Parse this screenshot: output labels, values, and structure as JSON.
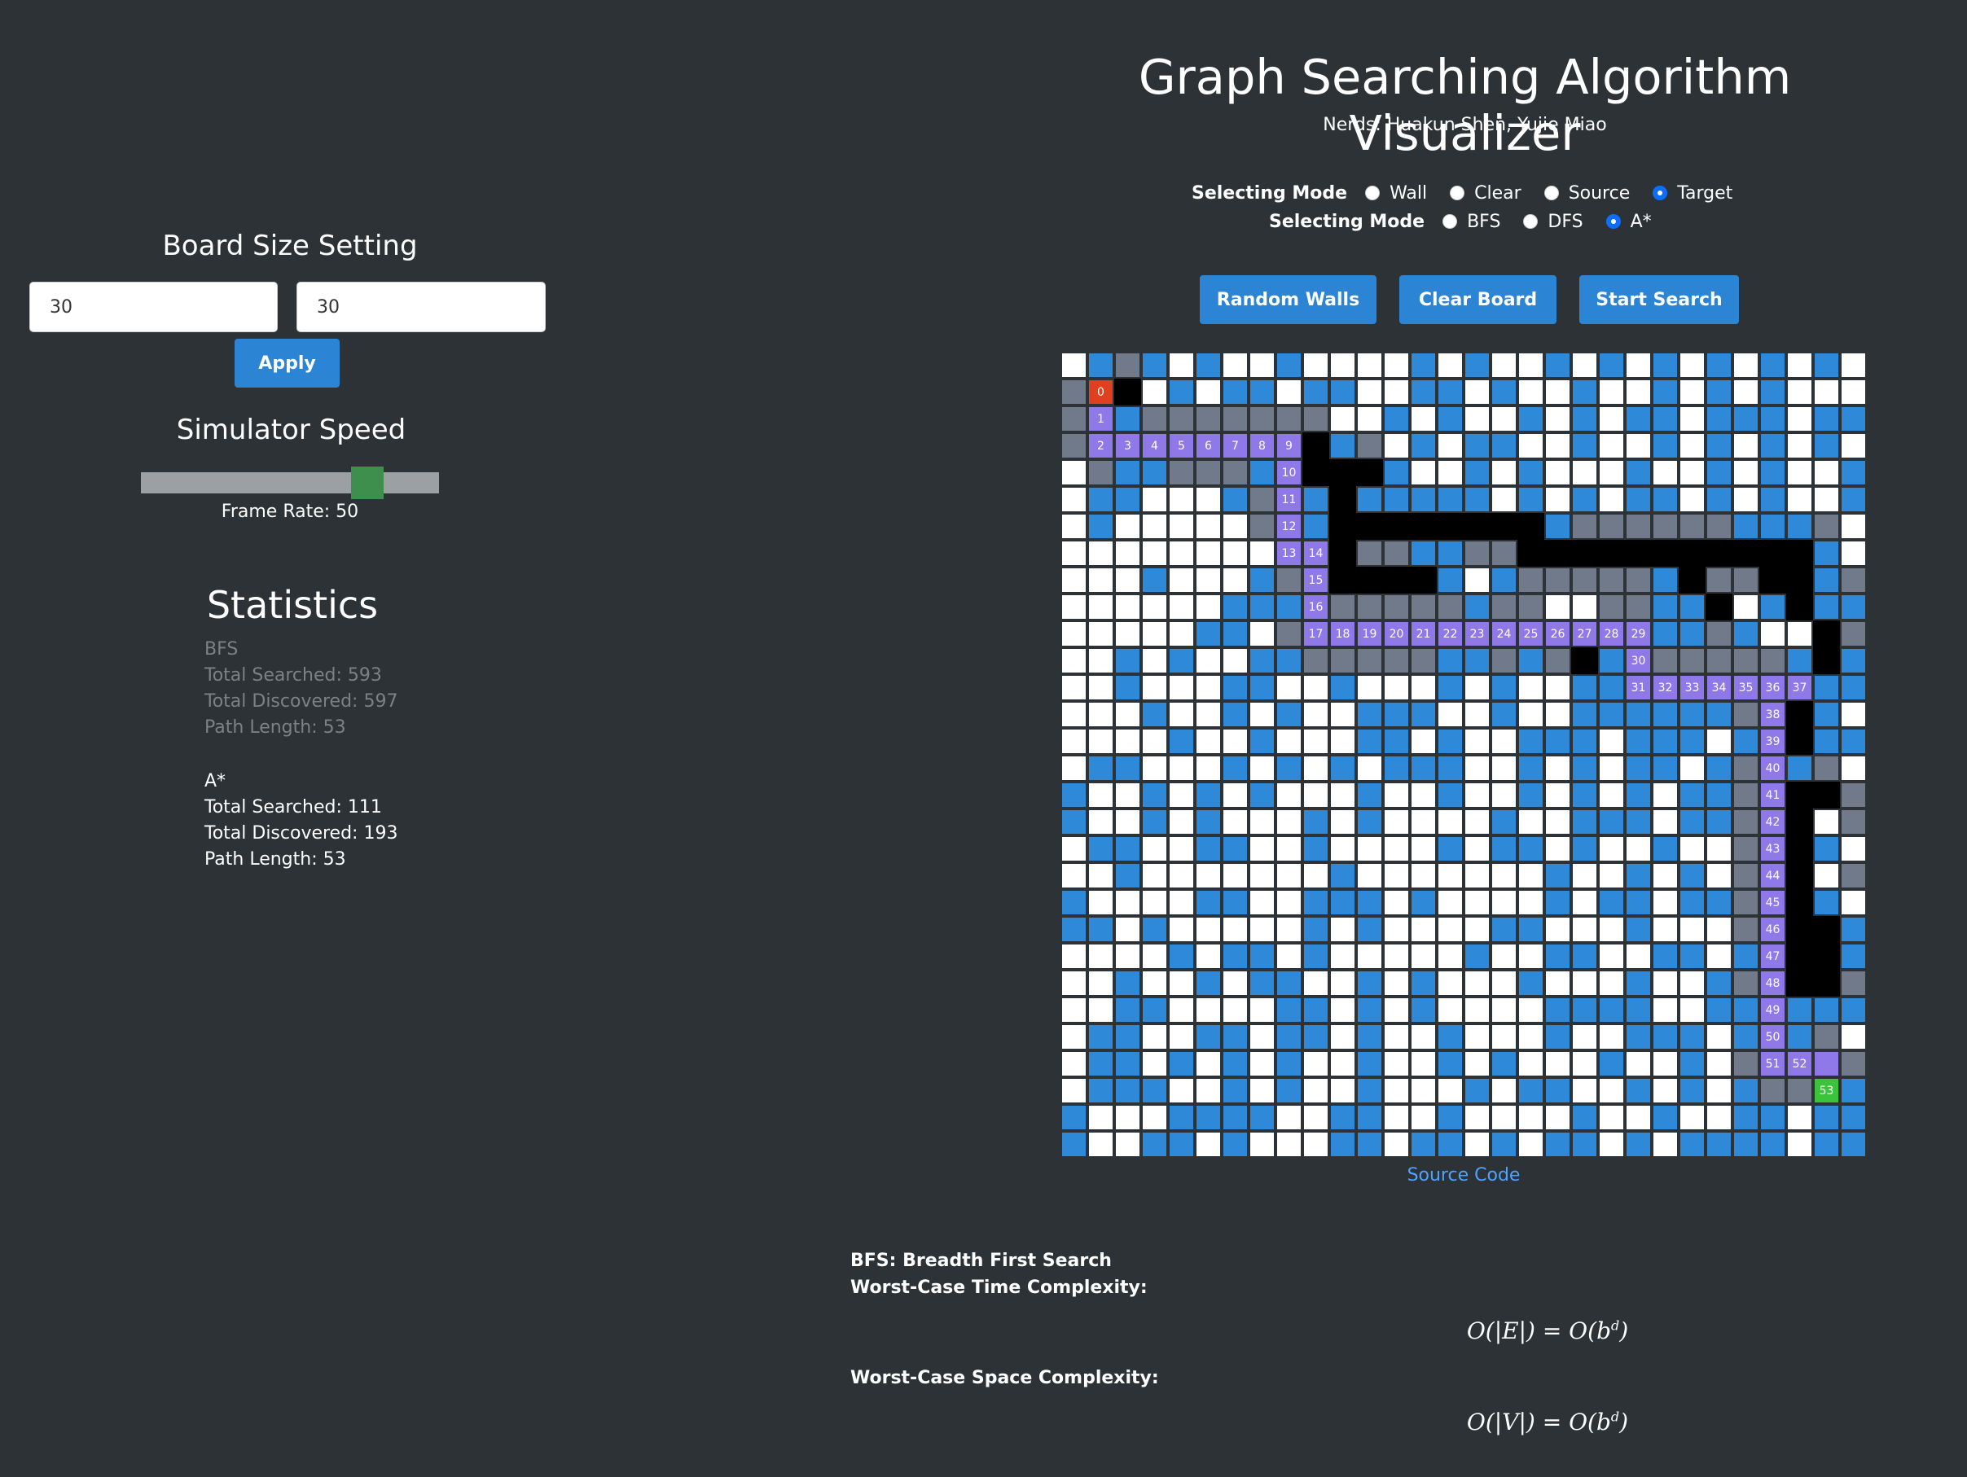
{
  "header": {
    "title": "Graph Searching Algorithm Visualizer",
    "subtitle": "Nerds: Huakun Shen, Yujie Miao"
  },
  "mode_row": {
    "label": "Selecting Mode",
    "options": [
      "Wall",
      "Clear",
      "Source",
      "Target"
    ],
    "selected": "Target"
  },
  "algo_row": {
    "label": "Selecting Mode",
    "options": [
      "BFS",
      "DFS",
      "A*"
    ],
    "selected": "A*"
  },
  "actions": {
    "random_walls": "Random Walls",
    "clear_board": "Clear Board",
    "start_search": "Start Search"
  },
  "board_settings": {
    "title": "Board Size Setting",
    "rows_value": "30",
    "cols_value": "30",
    "apply_label": "Apply"
  },
  "speed": {
    "title": "Simulator Speed",
    "frame_rate_text": "Frame Rate: 50",
    "slider_fraction": 0.79
  },
  "statistics": {
    "title": "Statistics",
    "bfs": {
      "name": "BFS",
      "total_searched": "Total Searched: 593",
      "total_discovered": "Total Discovered: 597",
      "path_length": "Path Length: 53"
    },
    "astar": {
      "name": "A*",
      "total_searched": "Total Searched: 111",
      "total_discovered": "Total Discovered: 193",
      "path_length": "Path Length: 53"
    }
  },
  "footer": {
    "source_link": "Source Code",
    "bfs_title": "BFS: Breadth First Search",
    "time_label": "Worst-Case Time Complexity:",
    "time_formula": "O(|E|) = O(b",
    "time_exp": "d",
    "space_label": "Worst-Case Space Complexity:",
    "space_formula": "O(|V|) = O(b",
    "space_exp": "d"
  },
  "colors": {
    "background": "#2c3236",
    "unvisited": "#ffffff",
    "discovered": "#2e8ad8",
    "searched": "#707a8a",
    "wall": "#000000",
    "path": "#8f79e8",
    "source": "#e0401f",
    "target": "#3bc43b",
    "button": "#2b84d4"
  },
  "grid": {
    "legend": "W=unvisited, B=discovered, G=searched, X=wall, S=source, T=target, P=path (labels in path_labels)",
    "rows": [
      "WBGBWBWWBWWWWBWBWWBWBWBWBWBWBW",
      "GSXWBWBBWBBWWBBWBWWBWWBWBWBWWW",
      "GPBGGGGGGGWWBWBWWBWBWBBWBBBWBB",
      "GPPPPPPPPXBGWBWBBWWBWWBWBWBWBW",
      "WGBBGGGBPXXXBWWBWBWWWBWWBWBWWB",
      "WBBWWWBGPBXBBBBBWBWBWBBWBWBWWB",
      "WBWWWWWGPBXXXXXXXXBGGGGGGBBBGW",
      "WWWWWWWWPPXGGBBGGXXXXXXXXXXXBW",
      "WWWBWWWBGPXXXXBWBGGGGGBXGGXXBG",
      "WWWWWWBBBPGGGGGBGGWWGGBBXWBXBB",
      "WWWWWBBWGPPPPPPPPPPPPPBBGBWWXG",
      "WWBWBWWBBGGGGGBBGBGXBPGGGGGBXB",
      "WWBWWWBBWWBWWWBWBWWBBPPPPPPPBB",
      "WWWBWWBWBWWBBBWWBWWBBBBBBGPXBW",
      "WWWWBWWBWWWBBWBWWBBBWBBBWBPXBB",
      "WBBWWWBWBWBWBBBWWBWBWBBWBGPBGW",
      "BWWBWBWBWWWBWWBWWBWBWBWBBGPXXG",
      "BWWBWBWWWBWBWWWWBWWBBBWBBGPXWG",
      "WBBWWBBWWBWWWWBWBBWBWWBWWGPXBW",
      "WWBWWWWWWWBWWWWWWWBWWBWBWGPXWG",
      "BWWWWBBWWBBBWBWWWWBWBBWBBGPXBW",
      "BBWBWWWWWBWBWWWWBBWWWBWWWGPXXB",
      "WWWWBWBBWBWWWWWBWWBBWWBBWBPXXB",
      "WWBWWBWBBWWBWBWWWBWWWBWWBGPXXG",
      "WWBBWWWWBBWBWBWWWWBBBBWWBBPBBB",
      "WBBWWBBWBBWBWWBWWWBWWBBBWBPBGW",
      "WBBWBWBWBWWBWWBWBWWWBWWBWGPPPG",
      "WBBBWWBWBWWBWWWBWBBWWBWBWBGGTB",
      "BWWWBBBBWWBBWWBWWWWBWWBWWBBWBB",
      "BWWBBWBWWWBBWBBWBWBBWBWBBBBWBB"
    ],
    "path_labels": [
      "1",
      "2",
      "3",
      "4",
      "5",
      "6",
      "7",
      "8",
      "9",
      "10",
      "11",
      "12",
      "13",
      "14",
      "15",
      "16",
      "17",
      "18",
      "19",
      "20",
      "21",
      "22",
      "23",
      "24",
      "25",
      "26",
      "27",
      "28",
      "29",
      "30",
      "31",
      "32",
      "33",
      "34",
      "35",
      "36",
      "37",
      "38",
      "39",
      "40",
      "41",
      "42",
      "43",
      "44",
      "45",
      "46",
      "47",
      "48",
      "49",
      "50",
      "51",
      "52"
    ],
    "source_label": "0",
    "target_label": "53"
  }
}
